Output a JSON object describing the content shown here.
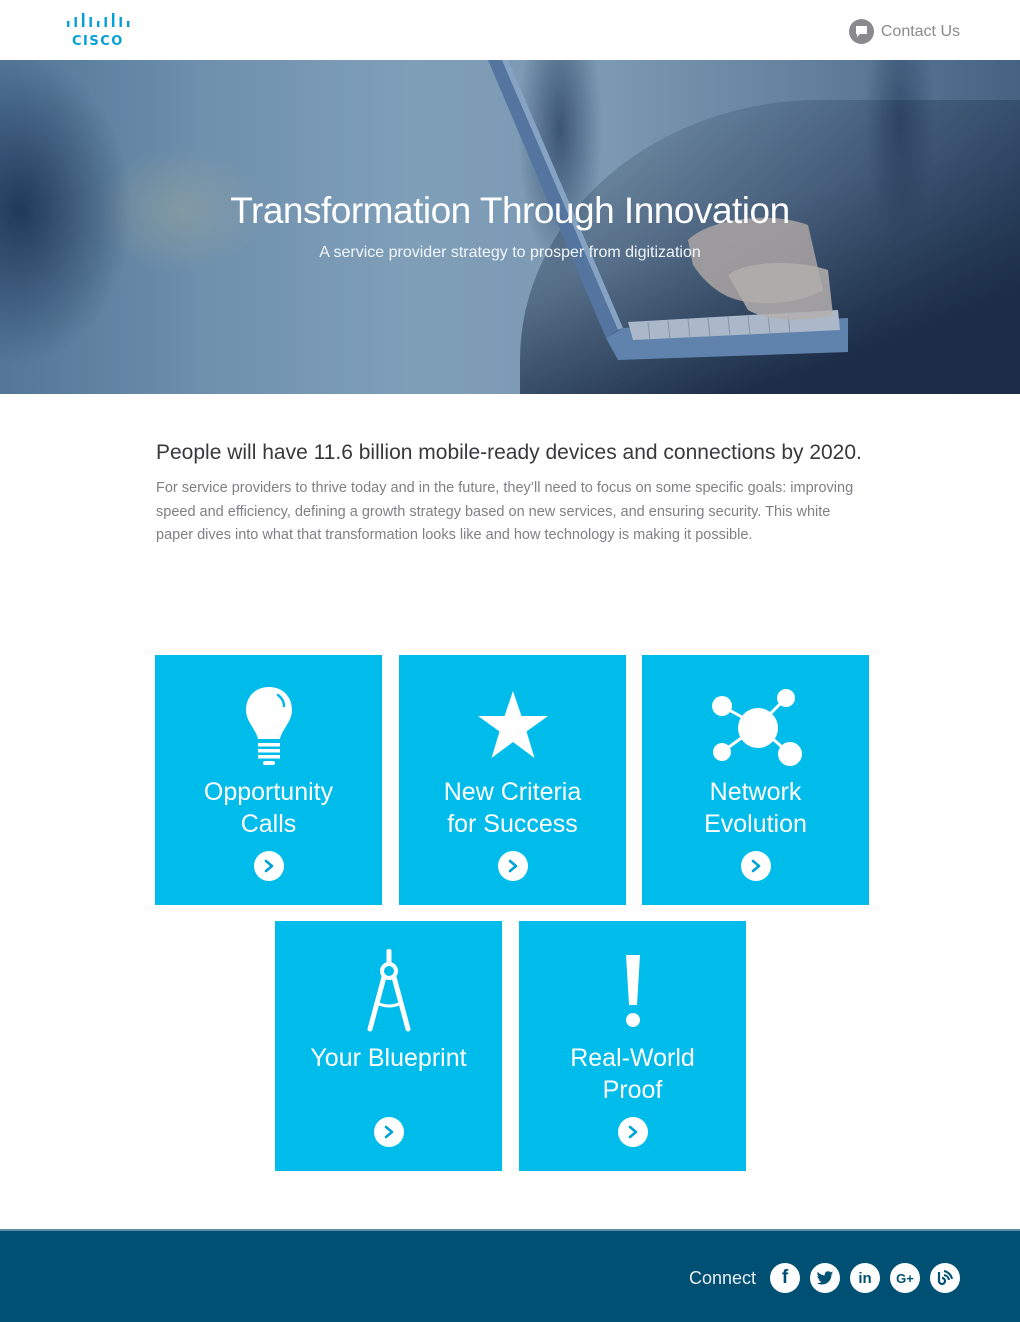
{
  "header": {
    "logo_text": "CISCO",
    "contact_label": "Contact Us"
  },
  "hero": {
    "title": "Transformation Through Innovation",
    "subtitle": "A service provider strategy to prosper from digitization"
  },
  "intro": {
    "headline": "People will have 11.6 billion mobile-ready devices and connections by 2020.",
    "body": "For service providers to thrive today and in the future, they’ll need to focus on some specific goals: improving speed and efficiency, defining a growth strategy based on new services, and ensuring security. This white paper dives into what that transformation looks like and how technology is making it possible."
  },
  "tiles": [
    {
      "label_line1": "Opportunity",
      "label_line2": "Calls",
      "icon": "lightbulb-icon"
    },
    {
      "label_line1": "New Criteria",
      "label_line2": "for Success",
      "icon": "star-icon"
    },
    {
      "label_line1": "Network",
      "label_line2": "Evolution",
      "icon": "network-icon"
    },
    {
      "label_line1": "Your Blueprint",
      "label_line2": "",
      "icon": "compass-icon"
    },
    {
      "label_line1": "Real-World",
      "label_line2": "Proof",
      "icon": "exclamation-icon"
    }
  ],
  "footer": {
    "connect_label": "Connect",
    "social": [
      {
        "name": "facebook",
        "glyph": "f"
      },
      {
        "name": "twitter",
        "glyph": ""
      },
      {
        "name": "linkedin",
        "glyph": "in"
      },
      {
        "name": "google-plus",
        "glyph": "G+"
      },
      {
        "name": "blog",
        "glyph": ""
      }
    ]
  },
  "colors": {
    "brand_blue": "#049fd9",
    "tile_cyan": "#00bceb",
    "footer_navy": "#005073",
    "text_dark": "#39393b",
    "text_gray": "#7f7f86"
  }
}
